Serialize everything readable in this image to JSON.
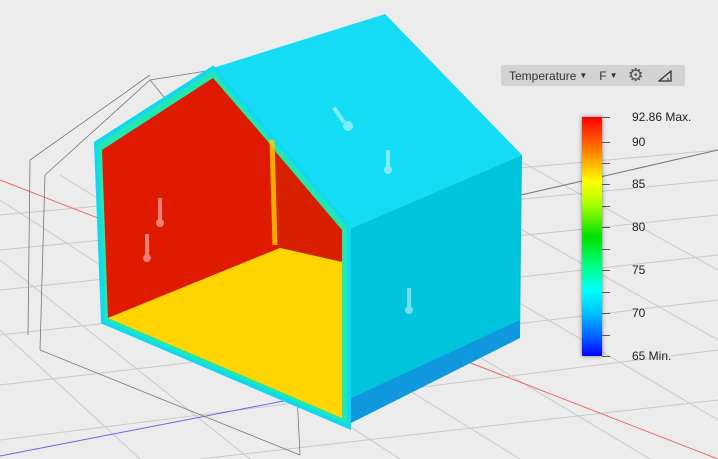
{
  "toolbar": {
    "result_type": "Temperature",
    "unit": "F",
    "settings_icon": "gear-icon",
    "probe_icon": "triangle-ruler-icon"
  },
  "legend": {
    "max_label": "92.86 Max.",
    "min_label": "65 Min.",
    "min": 65,
    "max": 92.86,
    "ticks": [
      {
        "value": 90,
        "label": "90"
      },
      {
        "value": 85,
        "label": "85"
      },
      {
        "value": 80,
        "label": "80"
      },
      {
        "value": 75,
        "label": "75"
      },
      {
        "value": 70,
        "label": "70"
      }
    ],
    "minor_ticks": [
      87.5,
      82.5,
      77.5,
      72.5,
      67.5
    ]
  },
  "colors": {
    "background": "#ececec",
    "exterior": "#10d8f0",
    "hot": "#e01a00",
    "warm": "#ffd800"
  }
}
